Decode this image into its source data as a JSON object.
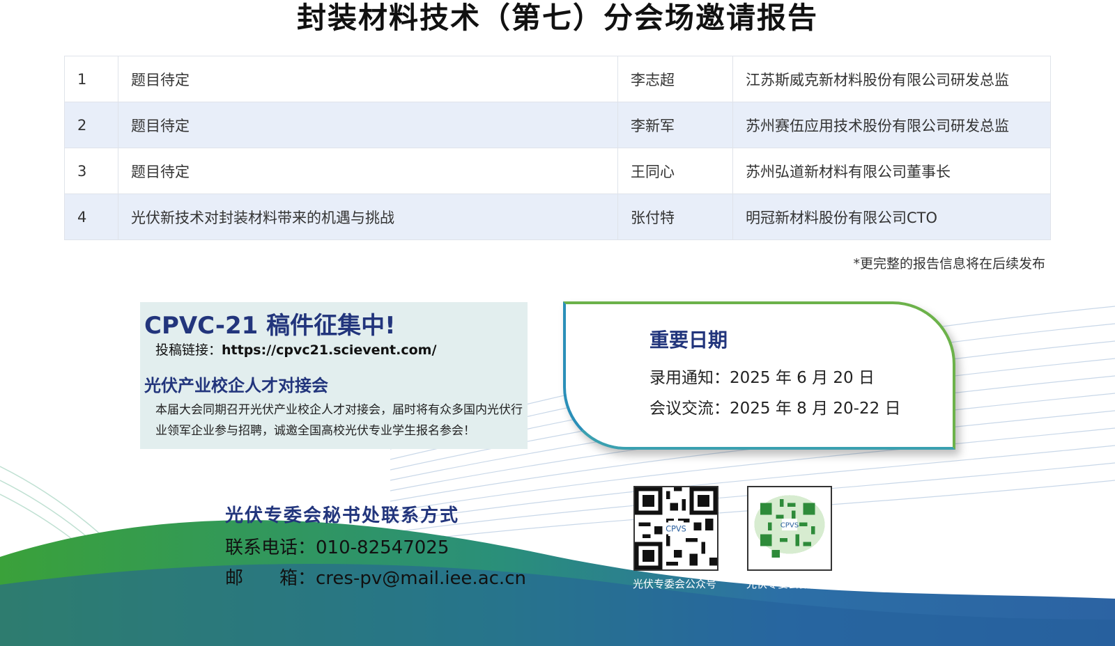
{
  "title": "封装材料技术（第七）分会场邀请报告",
  "reports": [
    {
      "num": "1",
      "topic": "题目待定",
      "speaker": "李志超",
      "org": "江苏斯威克新材料股份有限公司研发总监"
    },
    {
      "num": "2",
      "topic": "题目待定",
      "speaker": "李新军",
      "org": "苏州赛伍应用技术股份有限公司研发总监"
    },
    {
      "num": "3",
      "topic": "题目待定",
      "speaker": "王同心",
      "org": "苏州弘道新材料有限公司董事长"
    },
    {
      "num": "4",
      "topic": "光伏新技术对封装材料带来的机遇与挑战",
      "speaker": "张付特",
      "org": "明冠新材料股份有限公司CTO"
    }
  ],
  "note": "*更完整的报告信息将在后续发布",
  "call": {
    "title": "CPVC-21 稿件征集中!",
    "link_label": "投稿链接：",
    "link": "https://cpvc21.scievent.com/",
    "job_fair_title": "光伏产业校企人才对接会",
    "job_fair_desc": "本届大会同期召开光伏产业校企人才对接会，届时将有众多国内光伏行业领军企业参与招聘，诚邀全国高校光伏专业学生报名参会！"
  },
  "dates": {
    "title": "重要日期",
    "rows": [
      {
        "label": "录用通知：",
        "value": "2025 年 6 月 20 日"
      },
      {
        "label": "会议交流：",
        "value": "2025 年 8 月 20-22 日"
      }
    ]
  },
  "contact": {
    "title": "光伏专委会秘书处联系方式",
    "phone_label": "联系电话：",
    "phone": "010-82547025",
    "email_label": "邮　　箱：",
    "email": "cres-pv@mail.iee.ac.cn"
  },
  "qr": [
    {
      "label": "光伏专委会公众号",
      "logo": "CPVS"
    },
    {
      "label": "光伏专委会微信号",
      "logo": "CPVS"
    }
  ],
  "colors": {
    "accent": "#22357c",
    "row_alt": "#e8eef9",
    "green": "#3a9a3c",
    "blue": "#2a5f9e"
  }
}
